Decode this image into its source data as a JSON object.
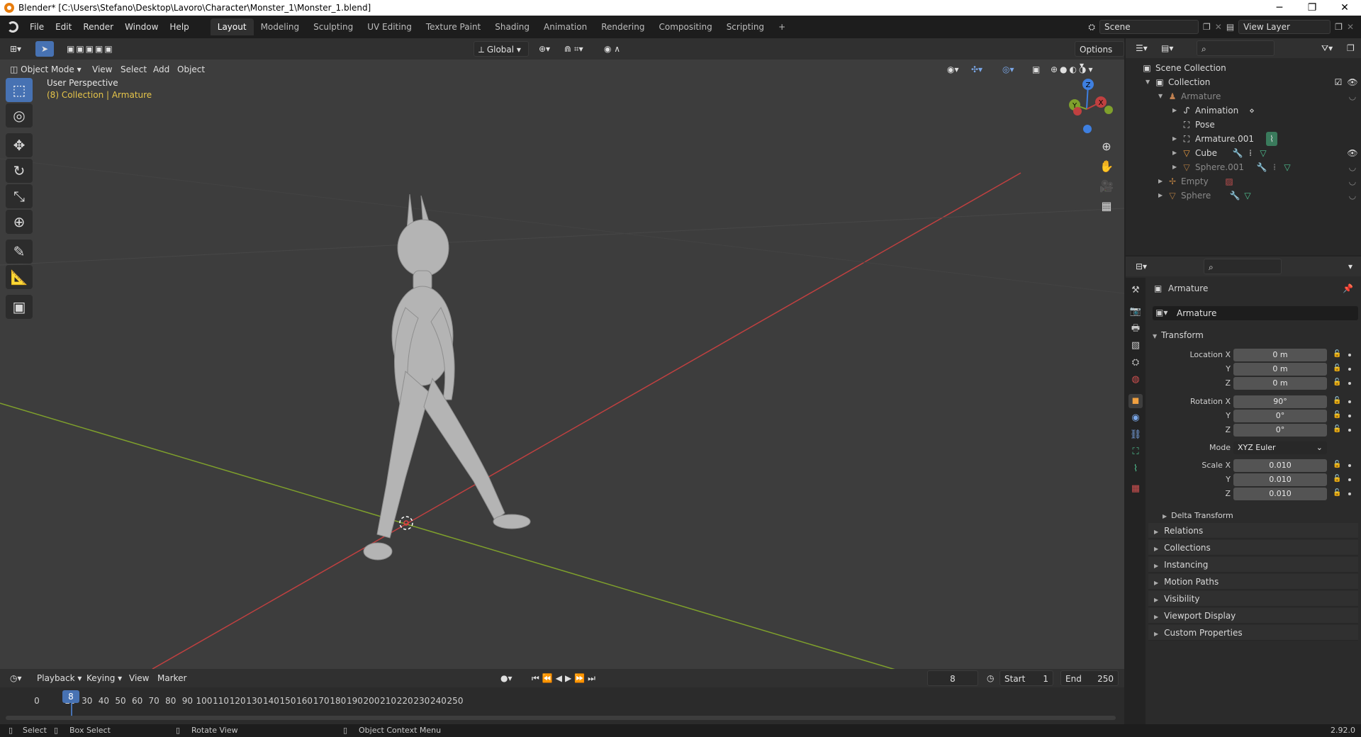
{
  "window": {
    "title": "Blender* [C:\\Users\\Stefano\\Desktop\\Lavoro\\Character\\Monster_1\\Monster_1.blend]",
    "minimize": "─",
    "maximize": "❐",
    "close": "✕"
  },
  "menu": [
    "File",
    "Edit",
    "Render",
    "Window",
    "Help"
  ],
  "workspaces": [
    "Layout",
    "Modeling",
    "Sculpting",
    "UV Editing",
    "Texture Paint",
    "Shading",
    "Animation",
    "Rendering",
    "Compositing",
    "Scripting"
  ],
  "workspace_add": "+",
  "scene": {
    "name": "Scene",
    "view_layer": "View Layer"
  },
  "viewport": {
    "mode": "Object Mode",
    "menus": [
      "View",
      "Select",
      "Add",
      "Object"
    ],
    "orientation": "Global",
    "options": "Options",
    "perspective": "User Perspective",
    "context": "(8) Collection | Armature",
    "gizmo": {
      "z": "Z",
      "y": "Y",
      "x": "X"
    }
  },
  "timeline": {
    "menus": [
      "Playback",
      "Keying",
      "View",
      "Marker"
    ],
    "current_frame": "8",
    "start_label": "Start",
    "start": "1",
    "end_label": "End",
    "end": "250",
    "ticks": [
      "0",
      "20",
      "30",
      "40",
      "50",
      "60",
      "70",
      "80",
      "90",
      "100",
      "110",
      "120",
      "130",
      "140",
      "150",
      "160",
      "170",
      "180",
      "190",
      "200",
      "210",
      "220",
      "230",
      "240",
      "250"
    ],
    "playhead": "8"
  },
  "status": {
    "select": "Select",
    "box_select": "Box Select",
    "rotate": "Rotate View",
    "context_menu": "Object Context Menu",
    "version": "2.92.0"
  },
  "outliner": {
    "scene_collection": "Scene Collection",
    "collection": "Collection",
    "items": [
      "Armature",
      "Animation",
      "Pose",
      "Armature.001",
      "Cube",
      "Sphere.001",
      "Empty",
      "Sphere"
    ]
  },
  "properties": {
    "header_object": "Armature",
    "object_name": "Armature",
    "transform": "Transform",
    "location": {
      "x_label": "Location X",
      "x": "0 m",
      "y_label": "Y",
      "y": "0 m",
      "z_label": "Z",
      "z": "0 m"
    },
    "rotation": {
      "x_label": "Rotation X",
      "x": "90°",
      "y_label": "Y",
      "y": "0°",
      "z_label": "Z",
      "z": "0°"
    },
    "mode_label": "Mode",
    "mode": "XYZ Euler",
    "scale": {
      "x_label": "Scale X",
      "x": "0.010",
      "y_label": "Y",
      "y": "0.010",
      "z_label": "Z",
      "z": "0.010"
    },
    "delta_transform": "Delta Transform",
    "panels": [
      "Relations",
      "Collections",
      "Instancing",
      "Motion Paths",
      "Visibility",
      "Viewport Display",
      "Custom Properties"
    ]
  },
  "colors": {
    "accent": "#4772b3",
    "x_axis": "#c04040",
    "y_axis": "#7fa02c",
    "z_axis": "#3e7fe0",
    "context_text": "#e6c54a"
  }
}
